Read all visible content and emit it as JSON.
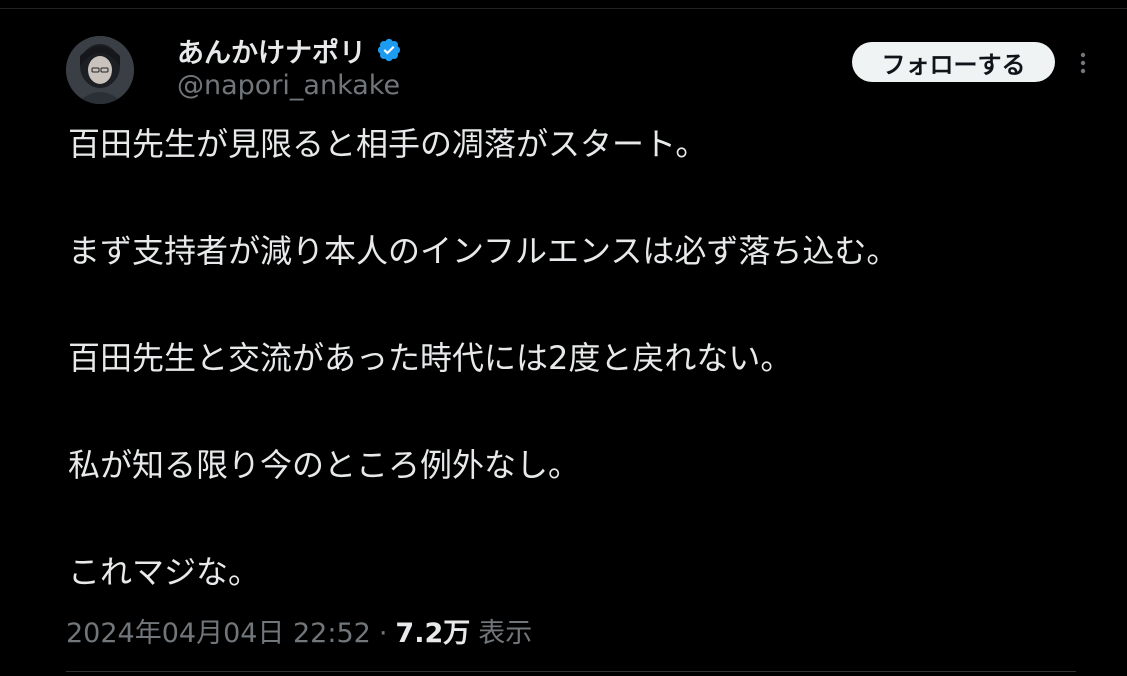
{
  "author": {
    "display_name": "あんかけナポリ",
    "handle": "@napori_ankake",
    "verified": true,
    "avatar_icon": "avatar-portrait-icon"
  },
  "actions": {
    "follow_label": "フォローする",
    "more_icon": "more-options-icon"
  },
  "tweet": {
    "lines": [
      "百田先生が見限ると相手の凋落がスタート。",
      "まず支持者が減り本人のインフルエンスは必ず落ち込む。",
      "百田先生と交流があった時代には2度と戻れない。",
      "私が知る限り今のところ例外なし。",
      "これマジな。"
    ]
  },
  "meta": {
    "timestamp": "2024年04月04日 22:52",
    "separator": "·",
    "views_count": "7.2万",
    "views_label": "表示"
  },
  "colors": {
    "background": "#000000",
    "text_primary": "#e7e9ea",
    "text_secondary": "#71767b",
    "verified_blue": "#1d9bf0",
    "follow_button_bg": "#eff3f4"
  }
}
